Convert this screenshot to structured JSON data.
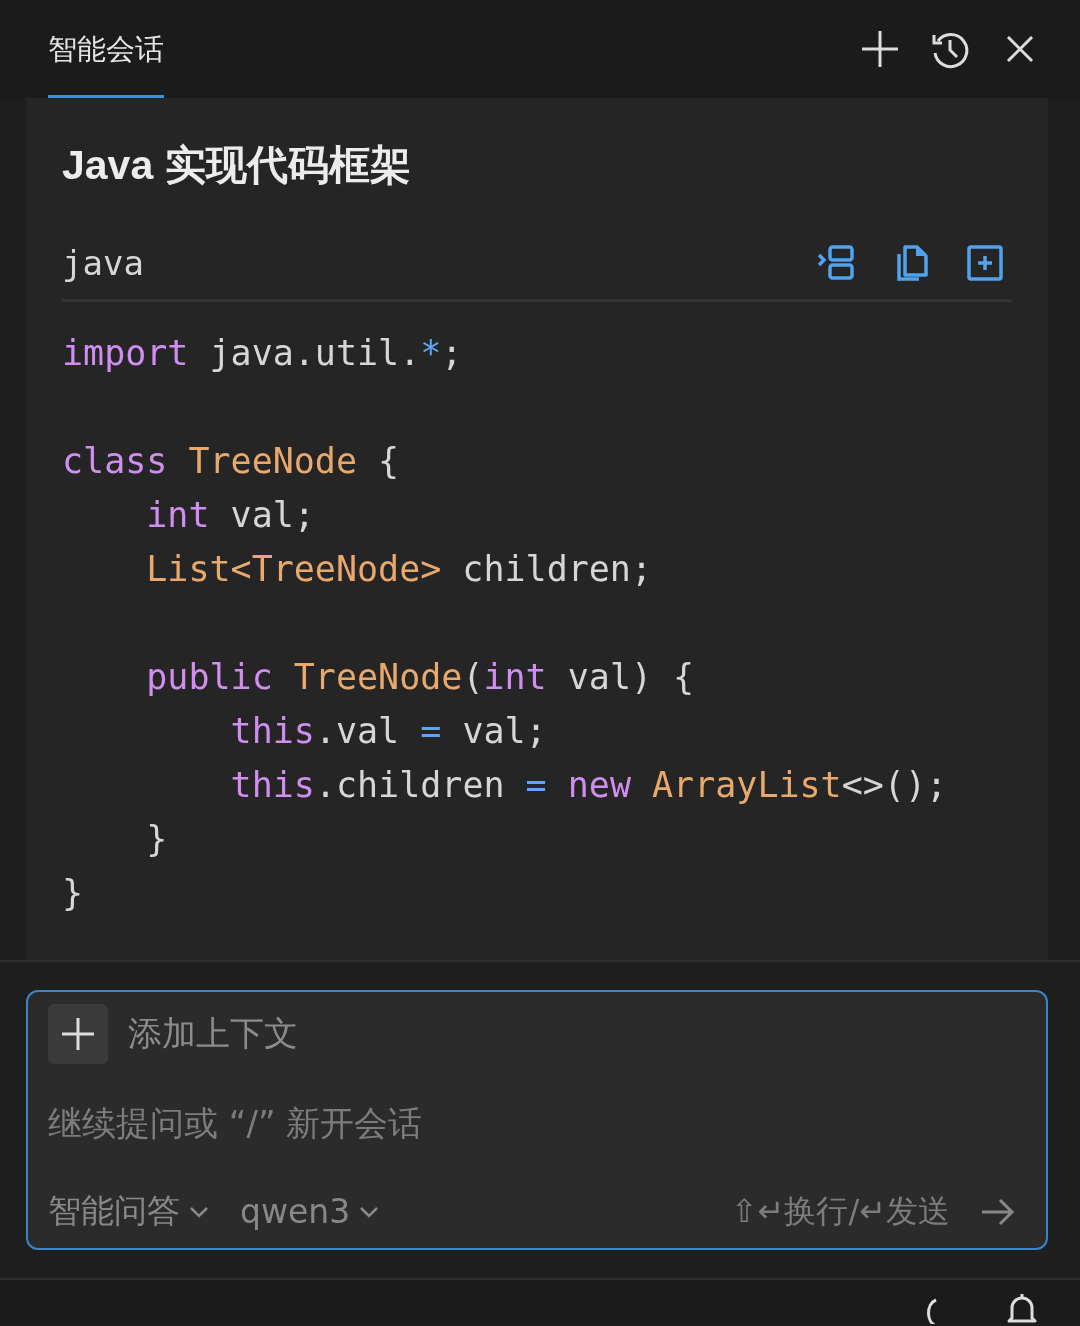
{
  "header": {
    "tabs": [
      {
        "label": "智能会话",
        "selected": true
      }
    ]
  },
  "answer": {
    "title": "Java 实现代码框架",
    "code_block": {
      "language": "java",
      "lines": [
        {
          "kind": "code",
          "tokens": [
            {
              "kind": "keyword",
              "text": "import"
            },
            {
              "kind": "plain",
              "text": " java.util."
            },
            {
              "kind": "operator",
              "text": "*"
            },
            {
              "kind": "plain",
              "text": ";"
            }
          ]
        },
        {
          "kind": "blank"
        },
        {
          "kind": "code",
          "tokens": [
            {
              "kind": "keyword",
              "text": "class "
            },
            {
              "kind": "type",
              "text": "TreeNode"
            },
            {
              "kind": "plain",
              "text": " {"
            }
          ]
        },
        {
          "kind": "code",
          "tokens": [
            {
              "kind": "keyword",
              "text": "    int"
            },
            {
              "kind": "plain",
              "text": " val;"
            }
          ]
        },
        {
          "kind": "code",
          "tokens": [
            {
              "kind": "type",
              "text": "    List<TreeNode>"
            },
            {
              "kind": "plain",
              "text": " children;"
            }
          ]
        },
        {
          "kind": "blank"
        },
        {
          "kind": "code",
          "tokens": [
            {
              "kind": "keyword",
              "text": "    public "
            },
            {
              "kind": "type",
              "text": "TreeNode"
            },
            {
              "kind": "plain",
              "text": "("
            },
            {
              "kind": "keyword",
              "text": "int"
            },
            {
              "kind": "plain",
              "text": " val) {"
            }
          ]
        },
        {
          "kind": "code",
          "tokens": [
            {
              "kind": "keyword",
              "text": "        this"
            },
            {
              "kind": "plain",
              "text": ".val "
            },
            {
              "kind": "operator",
              "text": "="
            },
            {
              "kind": "plain",
              "text": " val;"
            }
          ]
        },
        {
          "kind": "code",
          "tokens": [
            {
              "kind": "keyword",
              "text": "        this"
            },
            {
              "kind": "plain",
              "text": ".children "
            },
            {
              "kind": "operator",
              "text": "= "
            },
            {
              "kind": "keyword",
              "text": "new "
            },
            {
              "kind": "type",
              "text": "ArrayList"
            },
            {
              "kind": "plain",
              "text": "<>();"
            }
          ]
        },
        {
          "kind": "code",
          "tokens": [
            {
              "kind": "plain",
              "text": "    }"
            }
          ]
        },
        {
          "kind": "code",
          "tokens": [
            {
              "kind": "plain",
              "text": "}"
            }
          ]
        }
      ]
    }
  },
  "composer": {
    "context_button": {
      "label": "添加上下文"
    },
    "input": {
      "placeholder": "继续提问或 “/” 新开会话"
    },
    "mode": {
      "value": "智能问答"
    },
    "model": {
      "value": "qwen3"
    },
    "hint": "⇧↵换行/↵发送"
  }
}
